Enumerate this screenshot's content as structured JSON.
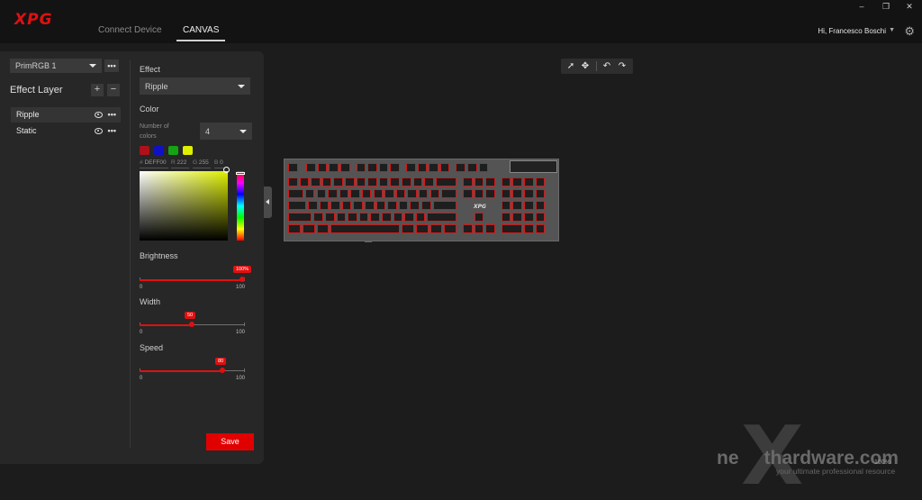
{
  "app": {
    "logo": "XPG",
    "tabs": [
      "Connect Device",
      "CANVAS"
    ],
    "active_tab": "CANVAS",
    "user_name": "Hi, Francesco Boschi",
    "window_controls": [
      "–",
      "❐",
      "✕"
    ]
  },
  "left": {
    "profile": "PrimRGB 1",
    "effect_layer_title": "Effect Layer",
    "layers": [
      {
        "label": "Ripple",
        "selected": true
      },
      {
        "label": "Static",
        "selected": false
      }
    ]
  },
  "effect": {
    "label": "Effect",
    "value": "Ripple"
  },
  "color": {
    "label": "Color",
    "num_colors_label": "Number of colors",
    "num_colors_value": "4",
    "swatches": [
      "#b0101a",
      "#1010c8",
      "#13a313",
      "#deef00"
    ],
    "hex_prefix": "#",
    "hex": "DEFF00",
    "r_prefix": "R",
    "r": "222",
    "g_prefix": "G",
    "g": "255",
    "b_prefix": "B",
    "b": "0"
  },
  "sliders": [
    {
      "label": "Brightness",
      "value": 100,
      "bubble": "100%",
      "min": "0",
      "max": "100"
    },
    {
      "label": "Width",
      "value": 50,
      "bubble": "50",
      "min": "0",
      "max": "100"
    },
    {
      "label": "Speed",
      "value": 80,
      "bubble": "80",
      "min": "0",
      "max": "100"
    }
  ],
  "save_label": "Save",
  "keyboard": {
    "logo": "XPG"
  },
  "watermark": {
    "brand_left": "ne",
    "brand_right": "thardware.com",
    "x_glyph": "X",
    "tagline": "your ultimate professional resource",
    "zoom": "100%"
  }
}
